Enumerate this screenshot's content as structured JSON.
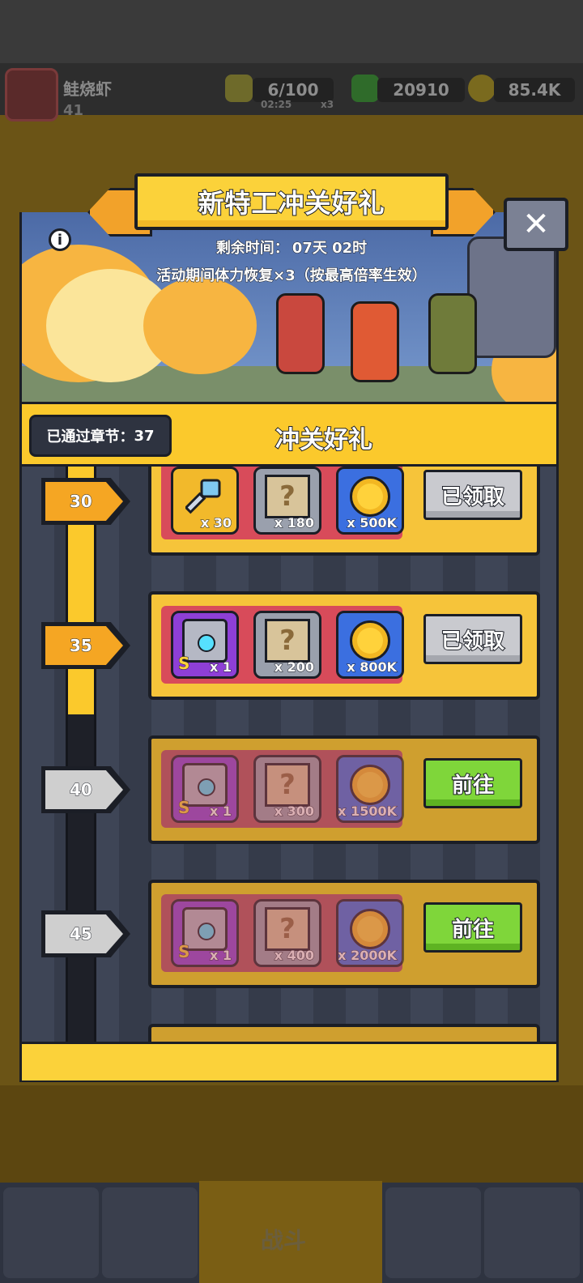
{
  "hud": {
    "player_name": "鲑烧虾",
    "player_level": "41",
    "stamina": "6/100",
    "stamina_timer": "02:25",
    "stamina_multiplier": "x3",
    "gems": "20910",
    "gold": "85.4K"
  },
  "popup": {
    "title": "新特工冲关好礼",
    "remaining_label": "剩余时间：",
    "remaining_value": "07天 02时",
    "bonus_text": "活动期间体力恢复×3（按最高倍率生效）",
    "section_title": "冲关好礼",
    "chapters_passed_label": "已通过章节：",
    "chapters_passed_value": "37",
    "close_symbol": "✕",
    "info_symbol": "i"
  },
  "progress": {
    "filled_fraction": 0.51
  },
  "rows": [
    {
      "chapter": "30",
      "status": "claimed",
      "button": "已领取",
      "rewards": [
        {
          "type": "key",
          "qty": "x 30"
        },
        {
          "type": "map",
          "qty": "x 180"
        },
        {
          "type": "coin",
          "qty": "x 500K"
        }
      ]
    },
    {
      "chapter": "35",
      "status": "claimed",
      "button": "已领取",
      "rewards": [
        {
          "type": "chest",
          "qty": "x 1",
          "grade": "S"
        },
        {
          "type": "map",
          "qty": "x 200"
        },
        {
          "type": "coin",
          "qty": "x 800K"
        }
      ]
    },
    {
      "chapter": "40",
      "status": "locked",
      "button": "前往",
      "rewards": [
        {
          "type": "chest",
          "qty": "x 1",
          "grade": "S"
        },
        {
          "type": "map",
          "qty": "x 300"
        },
        {
          "type": "coin",
          "qty": "x 1500K"
        }
      ]
    },
    {
      "chapter": "45",
      "status": "locked",
      "button": "前往",
      "rewards": [
        {
          "type": "chest",
          "qty": "x 1",
          "grade": "S"
        },
        {
          "type": "map",
          "qty": "x 400"
        },
        {
          "type": "coin",
          "qty": "x 2000K"
        }
      ]
    }
  ],
  "nav": {
    "battle_label": "战斗"
  },
  "colors": {
    "accent_yellow": "#fbc92c",
    "go_green": "#7fd63a",
    "claimed_gray": "#c9cacf"
  }
}
